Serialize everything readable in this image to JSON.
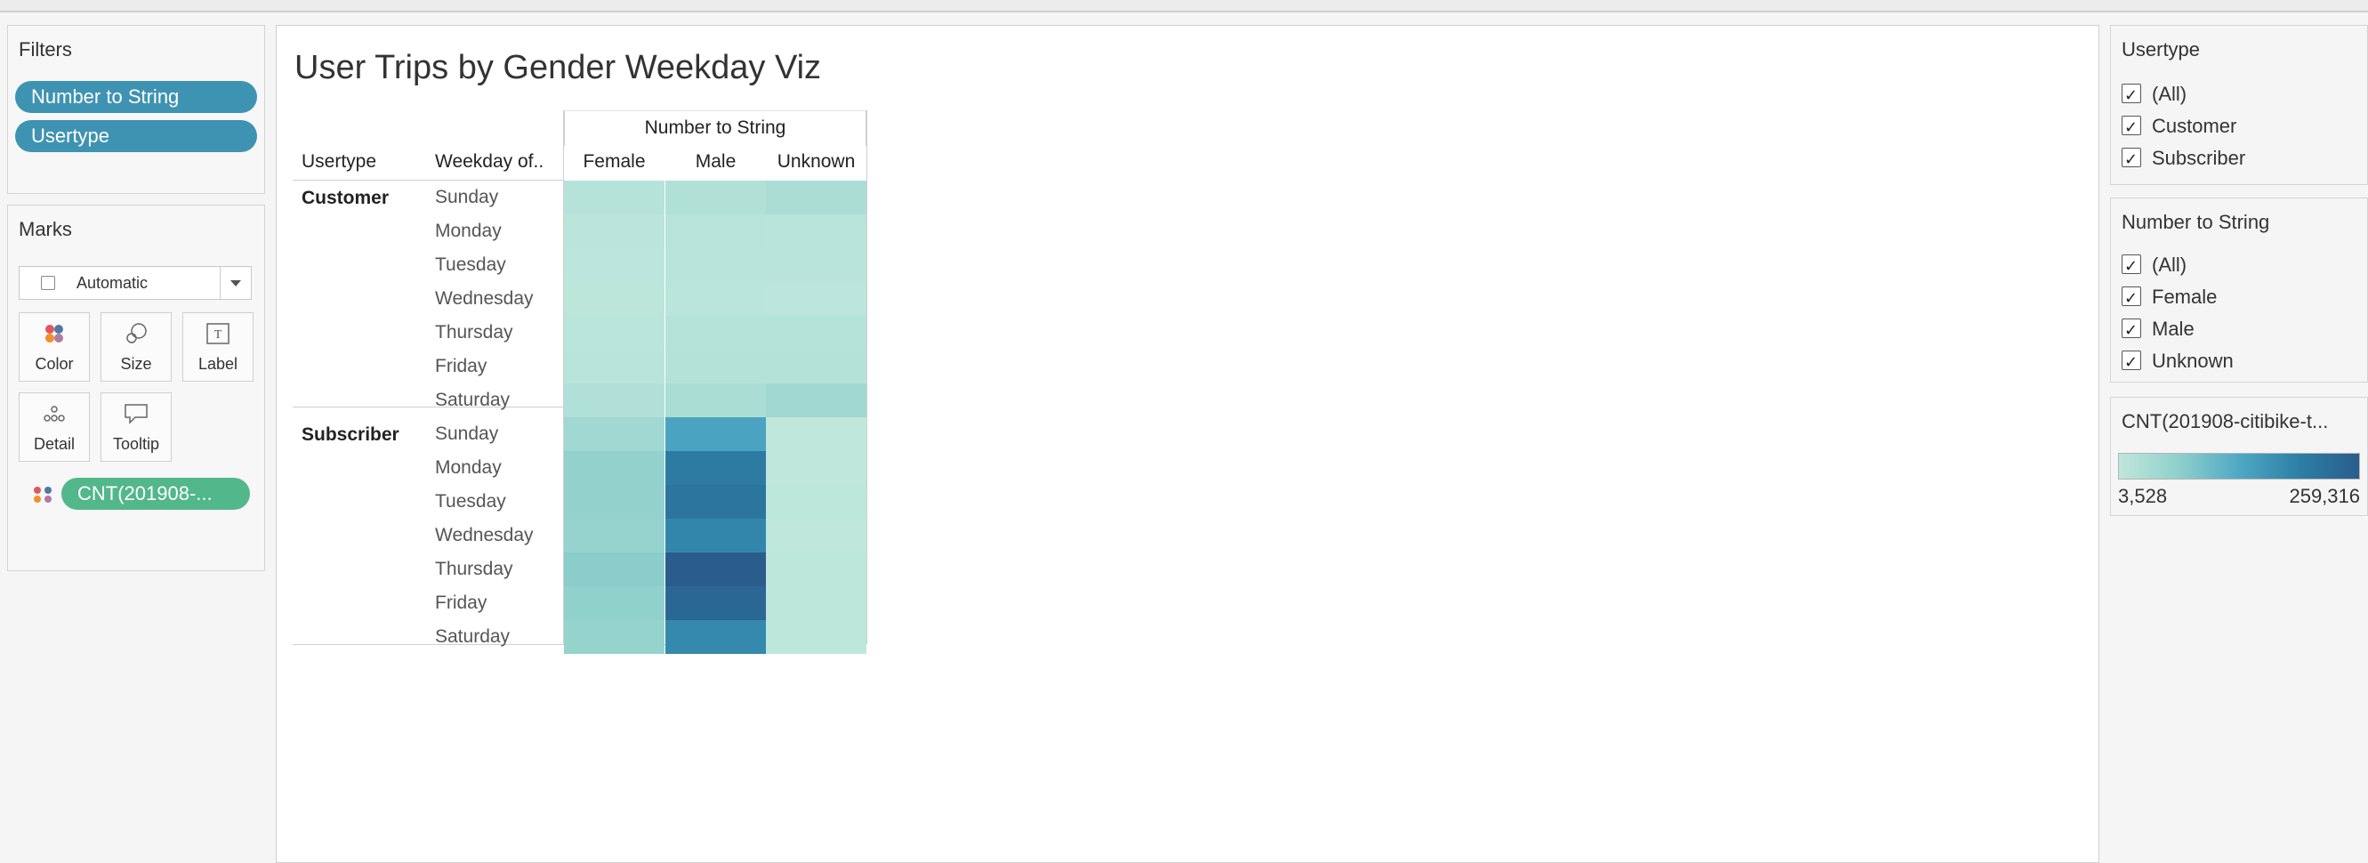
{
  "filters": {
    "title": "Filters",
    "pills": [
      "Number to String",
      "Usertype"
    ]
  },
  "marks": {
    "title": "Marks",
    "mark_type": "Automatic",
    "buttons": [
      "Color",
      "Size",
      "Label",
      "Detail",
      "Tooltip"
    ],
    "field_pill": "CNT(201908-..."
  },
  "viz": {
    "title": "User Trips by Gender Weekday Viz",
    "column_group_header": "Number to String",
    "row_headers": [
      "Usertype",
      "Weekday of.."
    ],
    "columns": [
      "Female",
      "Male",
      "Unknown"
    ]
  },
  "chart_data": {
    "type": "heatmap",
    "title": "User Trips by Gender Weekday Viz",
    "measure": "CNT(201908-citibike-t...",
    "columns": [
      "Female",
      "Male",
      "Unknown"
    ],
    "groups": [
      {
        "usertype": "Customer",
        "rows": [
          {
            "weekday": "Sunday",
            "values": [
              16000,
              22000,
              30000
            ]
          },
          {
            "weekday": "Monday",
            "values": [
              9000,
              14000,
              12000
            ]
          },
          {
            "weekday": "Tuesday",
            "values": [
              8000,
              12000,
              11000
            ]
          },
          {
            "weekday": "Wednesday",
            "values": [
              6000,
              10000,
              8000
            ]
          },
          {
            "weekday": "Thursday",
            "values": [
              10000,
              16000,
              16000
            ]
          },
          {
            "weekday": "Friday",
            "values": [
              11000,
              17000,
              18000
            ]
          },
          {
            "weekday": "Saturday",
            "values": [
              24000,
              32000,
              44000
            ]
          }
        ]
      },
      {
        "usertype": "Subscriber",
        "rows": [
          {
            "weekday": "Sunday",
            "values": [
              44000,
              140000,
              3528
            ]
          },
          {
            "weekday": "Monday",
            "values": [
              62000,
              205000,
              4000
            ]
          },
          {
            "weekday": "Tuesday",
            "values": [
              64000,
              215000,
              4200
            ]
          },
          {
            "weekday": "Wednesday",
            "values": [
              58000,
              185000,
              4100
            ]
          },
          {
            "weekday": "Thursday",
            "values": [
              72000,
              259316,
              4300
            ]
          },
          {
            "weekday": "Friday",
            "values": [
              66000,
              240000,
              4200
            ]
          },
          {
            "weekday": "Saturday",
            "values": [
              60000,
              180000,
              4400
            ]
          }
        ]
      }
    ],
    "color_min": 3528,
    "color_max": 259316,
    "color_range_colors": [
      "#bfe7dc",
      "#8fd0cb",
      "#4fa8c4",
      "#2d7fa6",
      "#2a5d8c"
    ]
  },
  "usertype_filter": {
    "title": "Usertype",
    "items": [
      "(All)",
      "Customer",
      "Subscriber"
    ]
  },
  "gender_filter": {
    "title": "Number to String",
    "items": [
      "(All)",
      "Female",
      "Male",
      "Unknown"
    ]
  },
  "legend": {
    "title": "CNT(201908-citibike-t...",
    "min_label": "3,528",
    "max_label": "259,316"
  }
}
